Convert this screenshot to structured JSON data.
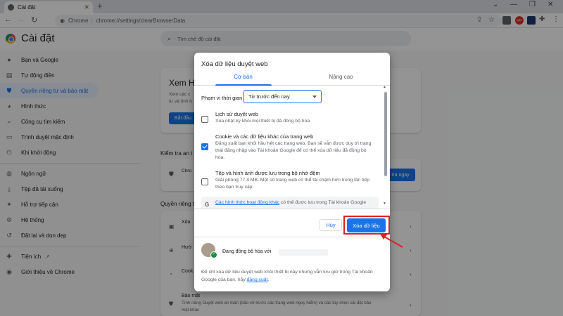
{
  "browser": {
    "tab_title": "Cài đặt",
    "tab_close": "✕",
    "new_tab": "+",
    "chip_label": "Chrome",
    "url_separator": "|",
    "url": "chrome://settings/clearBrowserData",
    "window_controls": [
      "⌄",
      "—",
      "❐",
      "✕"
    ],
    "extension_badge": "ABP"
  },
  "header": {
    "app_title": "Cài đặt",
    "search_placeholder": "Tìm chế độ cài đặt"
  },
  "sidebar": {
    "items": [
      {
        "label": "Bạn và Google",
        "icon": "person-icon",
        "glyph": "●"
      },
      {
        "label": "Tự động điền",
        "icon": "autofill-icon",
        "glyph": "▤"
      },
      {
        "label": "Quyền riêng tư và bảo mật",
        "icon": "shield-icon",
        "glyph": "⛊"
      },
      {
        "label": "Hình thức",
        "icon": "palette-icon",
        "glyph": "◕"
      },
      {
        "label": "Công cụ tìm kiếm",
        "icon": "search-icon",
        "glyph": "⌕"
      },
      {
        "label": "Trình duyệt mặc định",
        "icon": "browser-icon",
        "glyph": "▭"
      },
      {
        "label": "Khi khởi động",
        "icon": "power-icon",
        "glyph": "⏻"
      },
      {
        "label": "Ngôn ngữ",
        "icon": "globe-icon",
        "glyph": "◍"
      },
      {
        "label": "Tệp đã tải xuống",
        "icon": "download-icon",
        "glyph": "⤓"
      },
      {
        "label": "Hỗ trợ tiếp cận",
        "icon": "accessibility-icon",
        "glyph": "✦"
      },
      {
        "label": "Hệ thống",
        "icon": "wrench-icon",
        "glyph": "⚙"
      },
      {
        "label": "Đặt lại và dọn dẹp",
        "icon": "reset-icon",
        "glyph": "↺"
      },
      {
        "label": "Tiện ích",
        "icon": "puzzle-icon",
        "glyph": "✚"
      },
      {
        "label": "Giới thiệu về Chrome",
        "icon": "chrome-icon",
        "glyph": "◉"
      }
    ],
    "external_link_icon": "↗"
  },
  "background": {
    "card_title": "Xem H",
    "card_lines": [
      "Xem các c",
      "tư và tính b"
    ],
    "card_button": "Bắt đầu",
    "safety_heading": "Kiểm tra an t",
    "safety_text": "Chro",
    "safety_button": "tra ngay",
    "privacy_heading": "Quyền riêng t",
    "rows": [
      "Xóa",
      "Hướ",
      "Cook",
      "Bảo mật"
    ],
    "security_desc_1": "Tính năng Duyệt web an toàn (bảo vệ trước các trang web nguy hiểm) và các tùy chọn cài đặt bảo",
    "security_desc_2": "mật khác"
  },
  "dialog": {
    "title": "Xóa dữ liệu duyệt web",
    "tabs": [
      "Cơ bản",
      "Nâng cao"
    ],
    "time_range_label": "Phạm vi thời gian",
    "time_range_value": "Từ trước đến nay",
    "options": [
      {
        "title": "Lịch sử duyệt web",
        "desc": "Xóa nhật ký khỏi mọi thiết bị đã đồng bộ hóa",
        "checked": false
      },
      {
        "title": "Cookie và các dữ liệu khác của trang web",
        "desc": "Đăng xuất bạn khỏi hầu hết các trang web. Bạn sẽ vẫn được duy trì trạng thái đăng nhập vào Tài khoản Google để có thể xóa dữ liệu đã đồng bộ hóa.",
        "checked": true
      },
      {
        "title": "Tệp và hình ảnh được lưu trong bộ nhớ đệm",
        "desc": "Giải phóng 77,4 MB. Một số trang web có thể tải chậm hơn trong lần tiếp theo bạn truy cập.",
        "checked": false
      }
    ],
    "google_note_link": "Các hình thức hoạt động khác",
    "google_note_rest": " có thể được lưu trong Tài khoản Google",
    "cancel_label": "Hủy",
    "confirm_label": "Xóa dữ liệu",
    "sync_text": "Đang đồng bộ hóa với",
    "signout_text": "Để chỉ xóa dữ liệu duyệt web khỏi thiết bị này nhưng vẫn lưu giữ trong Tài khoản Google của bạn, hãy ",
    "signout_link": "đăng xuất",
    "signout_end": "."
  },
  "colors": {
    "accent": "#1a73e8",
    "highlight": "#e02020",
    "active_bg": "#e8f0fe"
  }
}
